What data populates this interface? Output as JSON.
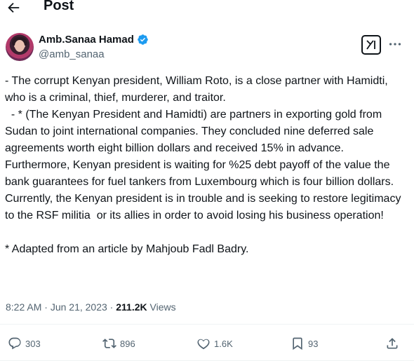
{
  "header": {
    "title": "Post"
  },
  "author": {
    "display_name": "Amb.Sanaa Hamad",
    "handle": "@amb_sanaa",
    "verified": true,
    "verified_color": "#1d9bf0"
  },
  "tweet": {
    "text": "- The corrupt Kenyan president, William Roto, is a close partner with Hamidti, who is a criminal, thief, murderer, and traitor.\n  - * (The Kenyan President and Hamidti) are partners in exporting gold from Sudan to joint international companies. They concluded nine deferred sale agreements worth eight billion dollars and received 15% in advance.\nFurthermore, Kenyan president is waiting for %25 debt payoff of the value the bank guarantees for fuel tankers from Luxembourg which is four billion dollars. Currently, the Kenyan president is in trouble and is seeking to restore legitimacy to the RSF militia  or its allies in order to avoid losing his business operation!\n\n* Adapted from an article by Mahjoub Fadl Badry."
  },
  "meta": {
    "time": "8:22 AM",
    "separator": " · ",
    "date": "Jun 21, 2023",
    "views_count": "211.2K",
    "views_label": "Views"
  },
  "actions": {
    "replies": "303",
    "reposts": "896",
    "likes": "1.6K",
    "bookmarks": "93"
  },
  "icons": [
    "back-arrow-icon",
    "verified-badge-icon",
    "grok-icon",
    "more-icon",
    "reply-icon",
    "repost-icon",
    "like-icon",
    "bookmark-icon",
    "share-icon"
  ]
}
